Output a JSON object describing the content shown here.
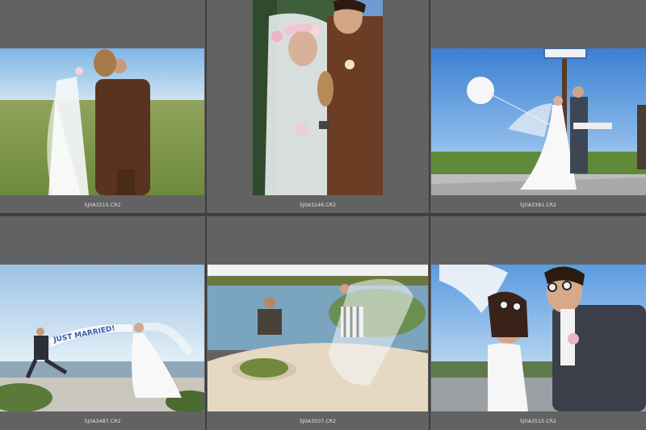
{
  "filmstrip": {
    "cells": [
      {
        "filename": "5J0A3215.CR2"
      },
      {
        "filename": "5J0A3246.CR2"
      },
      {
        "filename": "5J0A3381.CR2"
      },
      {
        "filename": "5J0A3487.CR2"
      },
      {
        "filename": "5J0A3507.CR2"
      },
      {
        "filename": "5J0A3515.CR2"
      }
    ],
    "banner_text": "JUST MARRIED!",
    "colors": {
      "cell_bg": "#626262",
      "gutter": "#3e3e3e",
      "filename_text": "#e8e8e8"
    }
  }
}
